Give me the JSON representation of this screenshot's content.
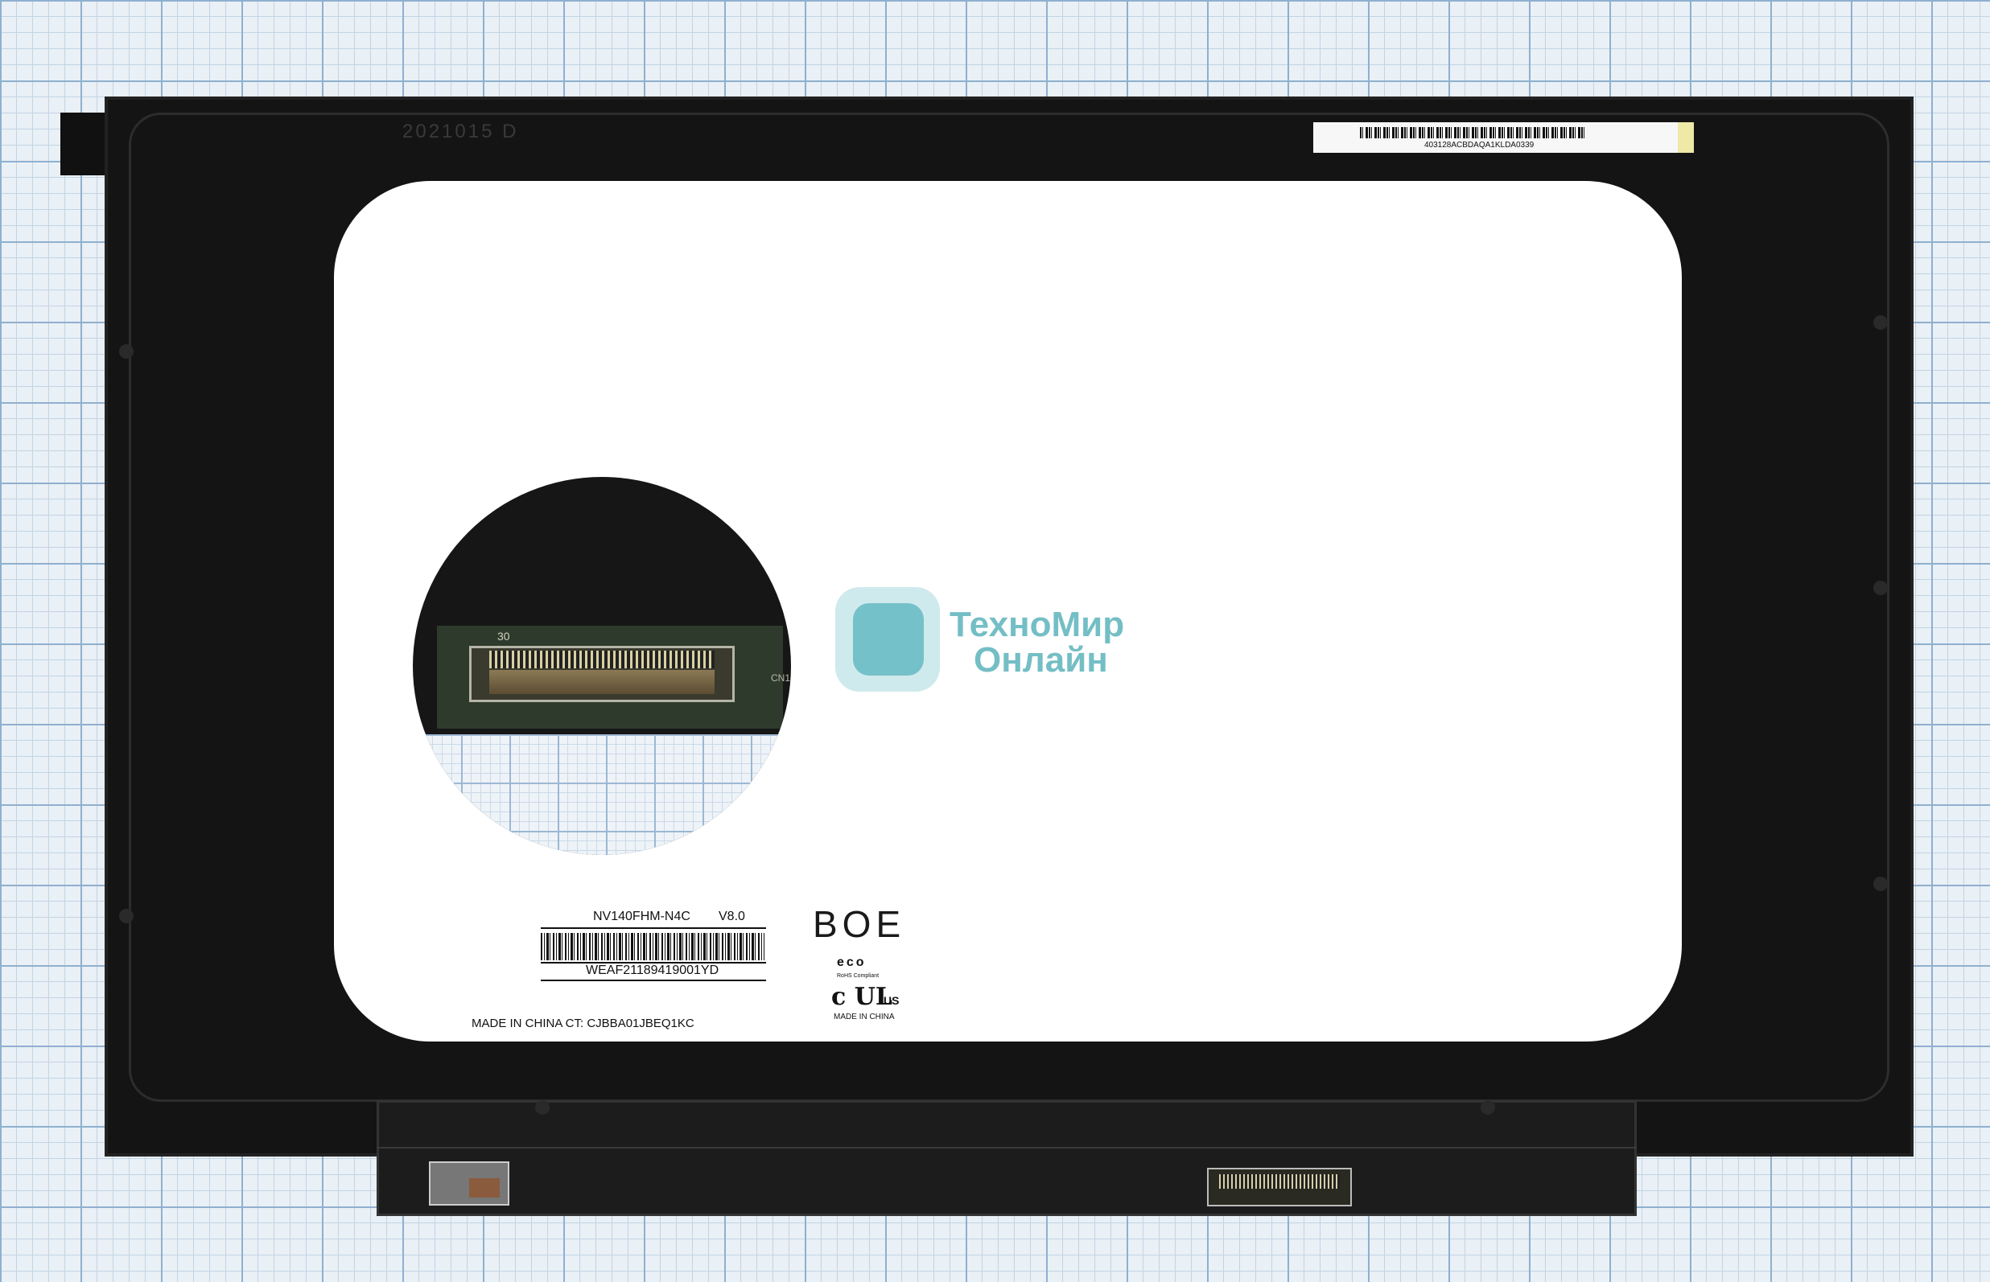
{
  "product": {
    "model": "NV140FHM-N4C",
    "version": "V8.0",
    "serial": "WEAF21189419001YD",
    "origin_line": "MADE IN CHINA  CT: CJBBA01JBEQ1KC",
    "top_sticker_code": "403128ACBDAQA1KLDA0339",
    "top_date_print": "2021015 D"
  },
  "brand": {
    "logo": "BOE",
    "eco_mark": "eco",
    "rohs": "RoHS Compliant",
    "ul_mark": "c UL",
    "ul_suffix": "US",
    "made_in": "MADE IN CHINA"
  },
  "inset": {
    "connector_number": "30",
    "connector_label": "CN1"
  },
  "watermark": {
    "line1": "ТехноМир",
    "line2": "Онлайн"
  },
  "colors": {
    "panel": "#141414",
    "screen": "#ffffff",
    "grid_paper": "#e9f0f6",
    "watermark_teal": "#5cb3bb"
  }
}
